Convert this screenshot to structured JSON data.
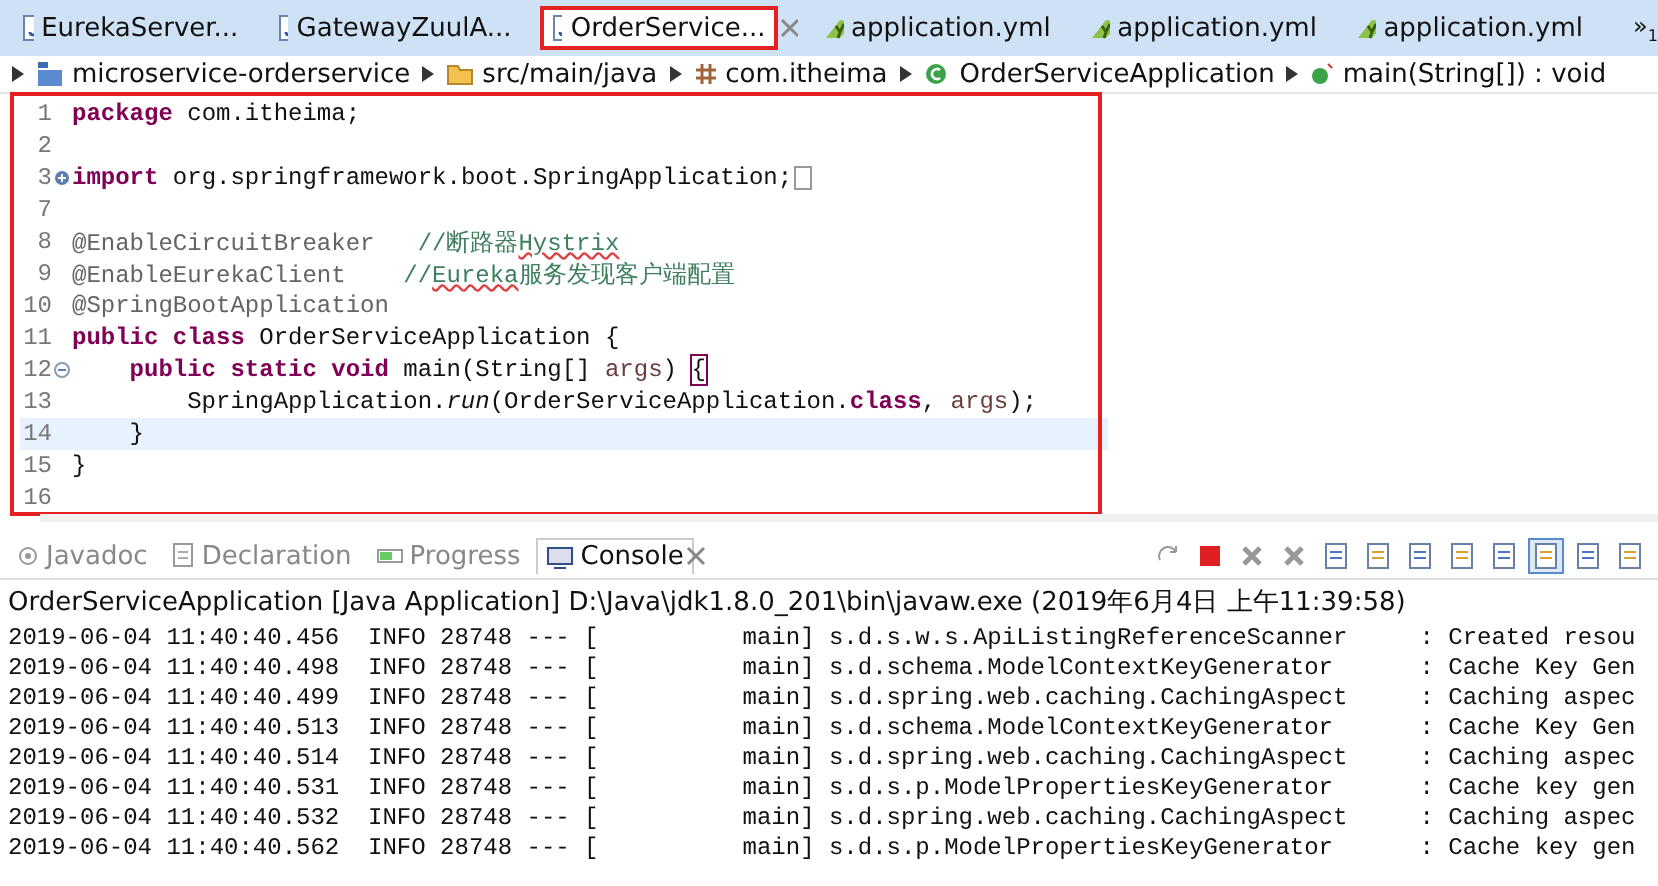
{
  "editor_tabs": [
    {
      "label": "EurekaServer...",
      "kind": "java",
      "selected": false,
      "highlighted": false
    },
    {
      "label": "GatewayZuulA...",
      "kind": "java",
      "selected": false,
      "highlighted": false
    },
    {
      "label": "OrderService...",
      "kind": "java",
      "selected": true,
      "highlighted": true
    },
    {
      "label": "application.yml",
      "kind": "yml",
      "selected": false,
      "highlighted": false
    },
    {
      "label": "application.yml",
      "kind": "yml",
      "selected": false,
      "highlighted": false
    },
    {
      "label": "application.yml",
      "kind": "yml",
      "selected": false,
      "highlighted": false
    }
  ],
  "overflow_tabs": {
    "symbol": "»",
    "count": "1"
  },
  "breadcrumb": [
    {
      "label": "microservice-orderservice",
      "kind": "project"
    },
    {
      "label": "src/main/java",
      "kind": "folder"
    },
    {
      "label": "com.itheima",
      "kind": "package"
    },
    {
      "label": "OrderServiceApplication",
      "kind": "class"
    },
    {
      "label": "main(String[]) : void",
      "kind": "method"
    }
  ],
  "editor": {
    "highlighted": true,
    "lines": [
      {
        "number": "1",
        "current": false,
        "segments": [
          {
            "kind": "keyword",
            "text": "package"
          },
          {
            "kind": "plain",
            "text": " com.itheima;"
          }
        ]
      },
      {
        "number": "2",
        "current": false
      },
      {
        "number": "3",
        "current": false,
        "collapsed": true,
        "segments": [
          {
            "kind": "keyword",
            "text": "import"
          },
          {
            "kind": "plain",
            "text": " org.springframework.boot.SpringApplication;"
          }
        ]
      },
      {
        "number": "7",
        "current": false
      },
      {
        "number": "8",
        "current": false,
        "segments": [
          {
            "kind": "annotation",
            "text": "@EnableCircuitBreaker   "
          },
          {
            "kind": "comment",
            "text": "//断路器"
          },
          {
            "kind": "misspelled",
            "text": "Hystrix"
          }
        ]
      },
      {
        "number": "9",
        "current": false,
        "segments": [
          {
            "kind": "annotation",
            "text": "@EnableEurekaClient    "
          },
          {
            "kind": "comment",
            "text": "//"
          },
          {
            "kind": "misspelled",
            "text": "Eureka"
          },
          {
            "kind": "comment",
            "text": "服务发现客户端配置"
          }
        ]
      },
      {
        "number": "10",
        "current": false,
        "segments": [
          {
            "kind": "annotation",
            "text": "@SpringBootApplication"
          }
        ]
      },
      {
        "number": "11",
        "current": false,
        "segments": [
          {
            "kind": "keyword",
            "text": "public class"
          },
          {
            "kind": "plain",
            "text": " OrderServiceApplication {"
          }
        ]
      },
      {
        "number": "12",
        "current": false,
        "collapsed": false,
        "segments": [
          {
            "kind": "keyword",
            "text": "    public static void"
          },
          {
            "kind": "plain",
            "text": " main(String[] "
          },
          {
            "kind": "param",
            "text": "args"
          },
          {
            "kind": "plain",
            "text": ") "
          },
          {
            "kind": "bracket",
            "text": "{"
          }
        ]
      },
      {
        "number": "13",
        "current": false,
        "segments": [
          {
            "kind": "plain",
            "text": "        SpringApplication."
          },
          {
            "kind": "italic",
            "text": "run"
          },
          {
            "kind": "plain",
            "text": "(OrderServiceApplication."
          },
          {
            "kind": "keyword",
            "text": "class"
          },
          {
            "kind": "plain",
            "text": ", "
          },
          {
            "kind": "param",
            "text": "args"
          },
          {
            "kind": "plain",
            "text": ");"
          }
        ]
      },
      {
        "number": "14",
        "current": true,
        "segments": [
          {
            "kind": "plain",
            "text": "    }"
          }
        ]
      },
      {
        "number": "15",
        "current": false,
        "segments": [
          {
            "kind": "plain",
            "text": "}"
          }
        ]
      },
      {
        "number": "16",
        "current": false
      }
    ]
  },
  "view_tabs": [
    {
      "label": "Javadoc",
      "kind": "javadoc",
      "selected": false
    },
    {
      "label": "Declaration",
      "kind": "declaration",
      "selected": false
    },
    {
      "label": "Progress",
      "kind": "progress",
      "selected": false
    },
    {
      "label": "Console",
      "kind": "console",
      "selected": true
    }
  ],
  "console": {
    "title": "OrderServiceApplication [Java Application] D:\\Java\\jdk1.8.0_201\\bin\\javaw.exe (2019年6月4日 上午11:39:58)",
    "lines": [
      "2019-06-04 11:40:40.456  INFO 28748 --- [          main] s.d.s.w.s.ApiListingReferenceScanner     : Created resou",
      "2019-06-04 11:40:40.498  INFO 28748 --- [          main] s.d.schema.ModelContextKeyGenerator      : Cache Key Gen",
      "2019-06-04 11:40:40.499  INFO 28748 --- [          main] s.d.spring.web.caching.CachingAspect     : Caching aspec",
      "2019-06-04 11:40:40.513  INFO 28748 --- [          main] s.d.schema.ModelContextKeyGenerator      : Cache Key Gen",
      "2019-06-04 11:40:40.514  INFO 28748 --- [          main] s.d.spring.web.caching.CachingAspect     : Caching aspec",
      "2019-06-04 11:40:40.531  INFO 28748 --- [          main] s.d.s.p.ModelPropertiesKeyGenerator      : Cache key gen",
      "2019-06-04 11:40:40.532  INFO 28748 --- [          main] s.d.spring.web.caching.CachingAspect     : Caching aspec",
      "2019-06-04 11:40:40.562  INFO 28748 --- [          main] s.d.s.p.ModelPropertiesKeyGenerator      : Cache key gen"
    ]
  }
}
